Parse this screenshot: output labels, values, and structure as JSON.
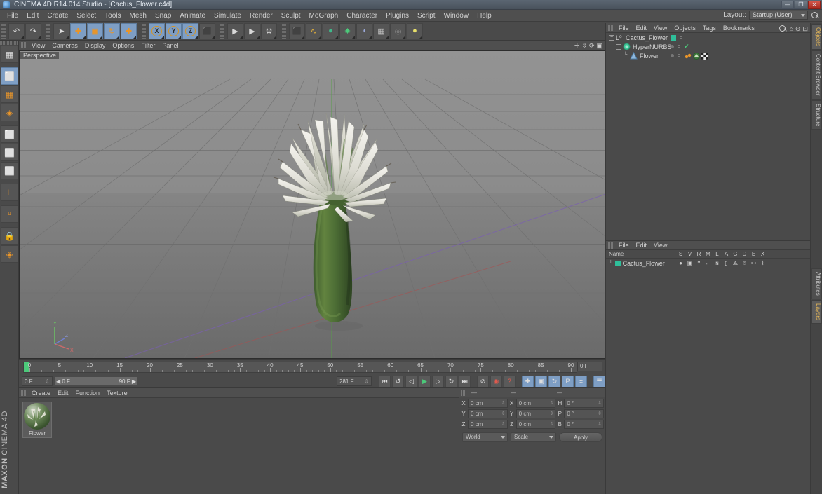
{
  "window": {
    "title": "CINEMA 4D R14.014 Studio - [Cactus_Flower.c4d]",
    "app_icon": "cinema4d-icon",
    "minimize": "—",
    "maximize": "❐",
    "close": "✕"
  },
  "menubar": {
    "items": [
      "File",
      "Edit",
      "Create",
      "Select",
      "Tools",
      "Mesh",
      "Snap",
      "Animate",
      "Simulate",
      "Render",
      "Sculpt",
      "MoGraph",
      "Character",
      "Plugins",
      "Script",
      "Window",
      "Help"
    ],
    "layout_label": "Layout:",
    "layout_value": "Startup (User)"
  },
  "toolbar": {
    "groups": [
      {
        "name": "undo-redo",
        "buttons": [
          {
            "name": "undo-button",
            "glyph": "↶"
          },
          {
            "name": "redo-button",
            "glyph": "↷"
          }
        ]
      },
      {
        "name": "transform-tools",
        "buttons": [
          {
            "name": "live-selection-tool",
            "glyph": "➤"
          },
          {
            "name": "move-tool",
            "glyph": "✚"
          },
          {
            "name": "scale-tool",
            "glyph": "▣"
          },
          {
            "name": "rotate-tool",
            "glyph": "↻"
          },
          {
            "name": "add-tool",
            "glyph": "✚"
          }
        ]
      },
      {
        "name": "axis-locks",
        "buttons": [
          {
            "name": "x-axis-lock",
            "glyph": "X"
          },
          {
            "name": "y-axis-lock",
            "glyph": "Y"
          },
          {
            "name": "z-axis-lock",
            "glyph": "Z"
          },
          {
            "name": "world-object-coord-toggle",
            "glyph": "⬛"
          }
        ]
      },
      {
        "name": "render-tools",
        "buttons": [
          {
            "name": "render-view-button",
            "glyph": "▶"
          },
          {
            "name": "render-region-button",
            "glyph": "▶"
          },
          {
            "name": "render-settings-button",
            "glyph": "⚙"
          }
        ]
      },
      {
        "name": "create-objects",
        "buttons": [
          {
            "name": "cube-primitive-button",
            "glyph": "⬛"
          },
          {
            "name": "spline-button",
            "glyph": "∿"
          },
          {
            "name": "nurbs-generator-button",
            "glyph": "●"
          },
          {
            "name": "array-modeling-button",
            "glyph": "✸"
          },
          {
            "name": "deformer-button",
            "glyph": "◖"
          },
          {
            "name": "scene-environment-button",
            "glyph": "▦"
          },
          {
            "name": "camera-button",
            "glyph": "◎"
          },
          {
            "name": "light-button",
            "glyph": "●"
          }
        ]
      }
    ]
  },
  "left_palette": {
    "buttons": [
      {
        "name": "texture-axis-tool",
        "glyph": "▦"
      },
      {
        "name": "model-mode-button",
        "glyph": "⬜"
      },
      {
        "name": "texture-mode-button",
        "glyph": "▦"
      },
      {
        "name": "polygon-mesh-mode-button",
        "glyph": "◈"
      },
      {
        "name": "points-mode-button",
        "glyph": "⬜"
      },
      {
        "name": "edges-mode-button",
        "glyph": "⬜"
      },
      {
        "name": "polygons-mode-button",
        "glyph": "⬜"
      },
      {
        "name": "axis-modification-button",
        "glyph": "L"
      },
      {
        "name": "enable-snapping-button",
        "glyph": "ᵘ"
      },
      {
        "name": "lock-workplane-button",
        "glyph": "🔒"
      },
      {
        "name": "workplane-button",
        "glyph": "◈"
      }
    ]
  },
  "branding": {
    "maxon": "MAXON",
    "product": "CINEMA 4D"
  },
  "viewport": {
    "menu_items": [
      "View",
      "Cameras",
      "Display",
      "Options",
      "Filter",
      "Panel"
    ],
    "label": "Perspective",
    "corner_icons": [
      "move-view-icon",
      "scale-view-icon",
      "rotate-view-icon",
      "maximize-view-icon"
    ],
    "axis_labels": {
      "y": "Y",
      "x": "X",
      "z": "Z"
    },
    "scene_object": "Cactus_Flower"
  },
  "timeline": {
    "ticks": [
      0,
      5,
      10,
      15,
      20,
      25,
      30,
      35,
      40,
      45,
      50,
      55,
      60,
      65,
      70,
      75,
      80,
      85,
      90
    ],
    "current_frame_right": "0 F",
    "start_field": "0 F",
    "range_start": "0 F",
    "range_end": "90 F",
    "end_field": "281 F",
    "playback_buttons": [
      {
        "name": "go-to-start-button",
        "glyph": "⏮"
      },
      {
        "name": "play-backwards-button",
        "glyph": "↺"
      },
      {
        "name": "previous-frame-button",
        "glyph": "◁"
      },
      {
        "name": "play-forward-button",
        "glyph": "▶"
      },
      {
        "name": "next-frame-button",
        "glyph": "▷"
      },
      {
        "name": "loop-button",
        "glyph": "↻"
      },
      {
        "name": "go-to-end-button",
        "glyph": "⏭"
      }
    ],
    "record_buttons": [
      {
        "name": "record-active-objects-button",
        "glyph": "⊘"
      },
      {
        "name": "autokeying-button",
        "glyph": "◉"
      },
      {
        "name": "keyframe-selection-button",
        "glyph": "?"
      }
    ],
    "key_toggles": [
      {
        "name": "position-key-button",
        "glyph": "✚"
      },
      {
        "name": "scale-key-button",
        "glyph": "▣"
      },
      {
        "name": "rotation-key-button",
        "glyph": "↻"
      },
      {
        "name": "parameter-key-button",
        "glyph": "P"
      },
      {
        "name": "pla-key-button",
        "glyph": "⠶"
      }
    ],
    "extra_button": {
      "name": "animation-layers-button",
      "glyph": "☰"
    }
  },
  "material_manager": {
    "menu_items": [
      "Create",
      "Edit",
      "Function",
      "Texture"
    ],
    "materials": [
      {
        "name": "Flower"
      }
    ]
  },
  "coordinate_manager": {
    "column_headers": [
      "—",
      "—",
      "—"
    ],
    "rows": [
      {
        "pos_label": "X",
        "pos_value": "0 cm",
        "size_label": "X",
        "size_value": "0 cm",
        "rot_label": "H",
        "rot_value": "0 °"
      },
      {
        "pos_label": "Y",
        "pos_value": "0 cm",
        "size_label": "Y",
        "size_value": "0 cm",
        "rot_label": "P",
        "rot_value": "0 °"
      },
      {
        "pos_label": "Z",
        "pos_value": "0 cm",
        "size_label": "Z",
        "size_value": "0 cm",
        "rot_label": "B",
        "rot_value": "0 °"
      }
    ],
    "coord_system": "World",
    "mode": "Scale",
    "apply_label": "Apply"
  },
  "object_manager": {
    "menu_items": [
      "File",
      "Edit",
      "View",
      "Objects",
      "Tags",
      "Bookmarks"
    ],
    "header_icons": [
      "search-icon",
      "home-icon",
      "minus-icon",
      "frame-icon"
    ],
    "objects": [
      {
        "name": "Cactus_Flower",
        "indent": 0,
        "icon": "null-object-icon",
        "expanded": true,
        "layer_chip": "#2fbf9a"
      },
      {
        "name": "HyperNURBS",
        "indent": 1,
        "icon": "hypernurbs-icon",
        "expanded": true,
        "check": "✔"
      },
      {
        "name": "Flower",
        "indent": 2,
        "icon": "polygon-object-icon",
        "expanded": false,
        "tags": [
          "phong-tag",
          "texture-tag",
          "uvw-tag"
        ]
      }
    ]
  },
  "attribute_manager": {
    "menu_items": [
      "File",
      "Edit",
      "View"
    ],
    "columns": [
      "Name",
      "S",
      "V",
      "R",
      "M",
      "L",
      "A",
      "G",
      "D",
      "E",
      "X"
    ],
    "rows": [
      {
        "name": "Cactus_Flower",
        "color": "#2fbf9a"
      }
    ]
  },
  "right_tabs": {
    "top": [
      {
        "label": "Objects",
        "active": true
      },
      {
        "label": "Content Browser",
        "active": false
      },
      {
        "label": "Structure",
        "active": false
      }
    ],
    "bottom": [
      {
        "label": "Attributes",
        "active": false
      },
      {
        "label": "Layers",
        "active": true
      }
    ]
  },
  "colors": {
    "accent_blue": "#7e9ec4",
    "accent_orange": "#e8952a",
    "green": "#4cc97a",
    "red": "#e05a4e",
    "panel_bg": "#4a4a4a",
    "header_bg": "#4f4f4f",
    "layer_teal": "#2fbf9a"
  }
}
